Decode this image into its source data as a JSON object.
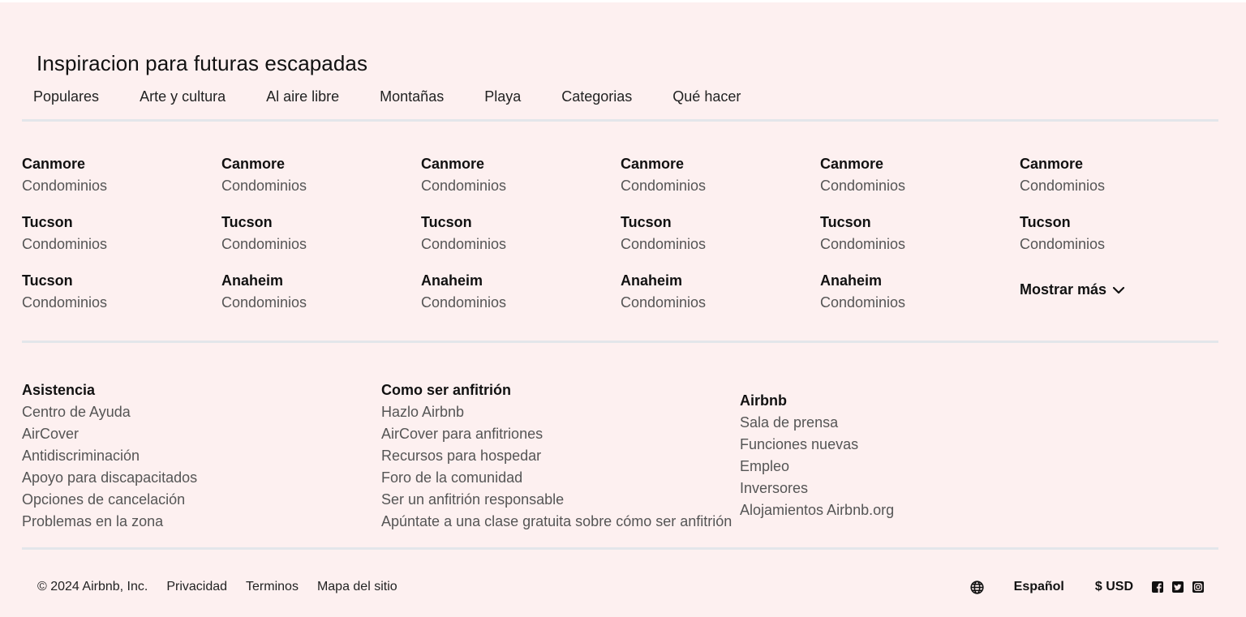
{
  "section": {
    "title": "Inspiracion para futuras escapadas",
    "tabs": [
      "Populares",
      "Arte y cultura",
      "Al aire libre",
      "Montañas",
      "Playa",
      "Categorias",
      "Qué hacer"
    ]
  },
  "destinations": [
    {
      "city": "Canmore",
      "type": "Condominios"
    },
    {
      "city": "Canmore",
      "type": "Condominios"
    },
    {
      "city": "Canmore",
      "type": "Condominios"
    },
    {
      "city": "Canmore",
      "type": "Condominios"
    },
    {
      "city": "Canmore",
      "type": "Condominios"
    },
    {
      "city": "Canmore",
      "type": "Condominios"
    },
    {
      "city": "Tucson",
      "type": "Condominios"
    },
    {
      "city": "Tucson",
      "type": "Condominios"
    },
    {
      "city": "Tucson",
      "type": "Condominios"
    },
    {
      "city": "Tucson",
      "type": "Condominios"
    },
    {
      "city": "Tucson",
      "type": "Condominios"
    },
    {
      "city": "Tucson",
      "type": "Condominios"
    },
    {
      "city": "Tucson",
      "type": "Condominios"
    },
    {
      "city": "Anaheim",
      "type": "Condominios"
    },
    {
      "city": "Anaheim",
      "type": "Condominios"
    },
    {
      "city": "Anaheim",
      "type": "Condominios"
    },
    {
      "city": "Anaheim",
      "type": "Condominios"
    }
  ],
  "show_more": {
    "label": "Mostrar más",
    "icon": "chevron-down-icon"
  },
  "footer": {
    "columns": [
      {
        "heading": "Asistencia",
        "links": [
          "Centro de Ayuda",
          "AirCover",
          "Antidiscriminación",
          "Apoyo para discapacitados",
          "Opciones de cancelación",
          "Problemas en la zona"
        ]
      },
      {
        "heading": "Como ser anfitrión",
        "links": [
          "Hazlo Airbnb",
          "AirCover para anfitriones",
          "Recursos para hospedar",
          "Foro de la comunidad",
          "Ser un anfitrión responsable",
          "Apúntate a una clase gratuita sobre cómo ser anfitrión"
        ]
      },
      {
        "heading": "Airbnb",
        "links": [
          "Sala de prensa",
          "Funciones nuevas",
          "Empleo",
          "Inversores",
          "Alojamientos Airbnb.org"
        ]
      }
    ],
    "bottom": {
      "copyright": "© 2024 Airbnb, Inc.",
      "links": [
        "Privacidad",
        "Terminos",
        "Mapa del sitio"
      ],
      "language": "Español",
      "currency": "$ USD",
      "icons": [
        "globe-icon",
        "facebook-icon",
        "twitter-icon",
        "instagram-icon"
      ]
    }
  },
  "colors": {
    "background": "#fdf0f0",
    "divider": "#e3e6ea",
    "muted_text": "#555555"
  }
}
